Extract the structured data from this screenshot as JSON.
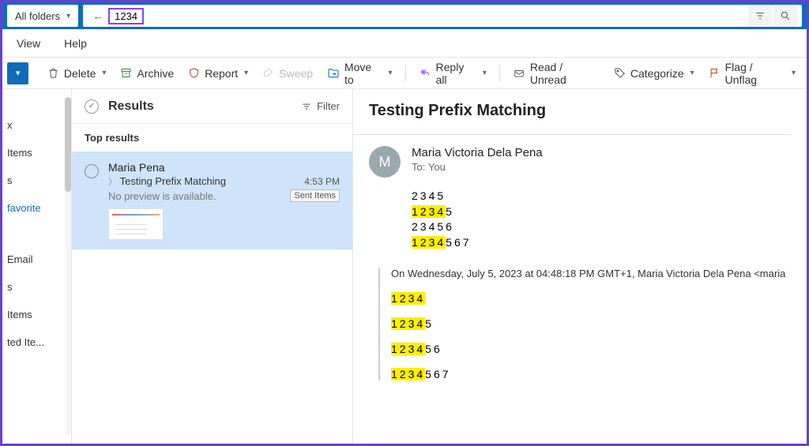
{
  "search": {
    "folder_selector": "All folders",
    "query": "1234"
  },
  "menu": {
    "view": "View",
    "help": "Help"
  },
  "toolbar": {
    "delete": "Delete",
    "archive": "Archive",
    "report": "Report",
    "sweep": "Sweep",
    "move": "Move to",
    "reply": "Reply all",
    "readunread": "Read / Unread",
    "categorize": "Categorize",
    "flag": "Flag / Unflag"
  },
  "sidebar": {
    "items": [
      "x",
      "Items",
      "s",
      "favorite",
      "Email",
      "s",
      "Items",
      "ted Ite..."
    ]
  },
  "list": {
    "header_title": "Results",
    "filter": "Filter",
    "top_results": "Top results",
    "result": {
      "sender": "Maria Pena",
      "subject": "Testing Prefix Matching",
      "time": "4:53 PM",
      "preview": "No preview is available.",
      "folder": "Sent Items"
    }
  },
  "reading": {
    "subject": "Testing Prefix Matching",
    "avatar_initial": "M",
    "sender": "Maria Victoria Dela Pena",
    "to_label": "To:",
    "to_value": "You",
    "body": {
      "l1": "2345",
      "l2_hl": "1234",
      "l2_rest": "5",
      "l3": "23456",
      "l4_hl": "1234",
      "l4_rest": "567"
    },
    "quote_header": "On Wednesday, July 5, 2023 at 04:48:18 PM GMT+1, Maria Victoria Dela Pena <maria",
    "quote": {
      "q1_hl": "1234",
      "q2_hl": "1234",
      "q2_rest": "5",
      "q3_hl": "1234",
      "q3_rest": "56",
      "q4_hl": "1234",
      "q4_rest": "567"
    }
  }
}
